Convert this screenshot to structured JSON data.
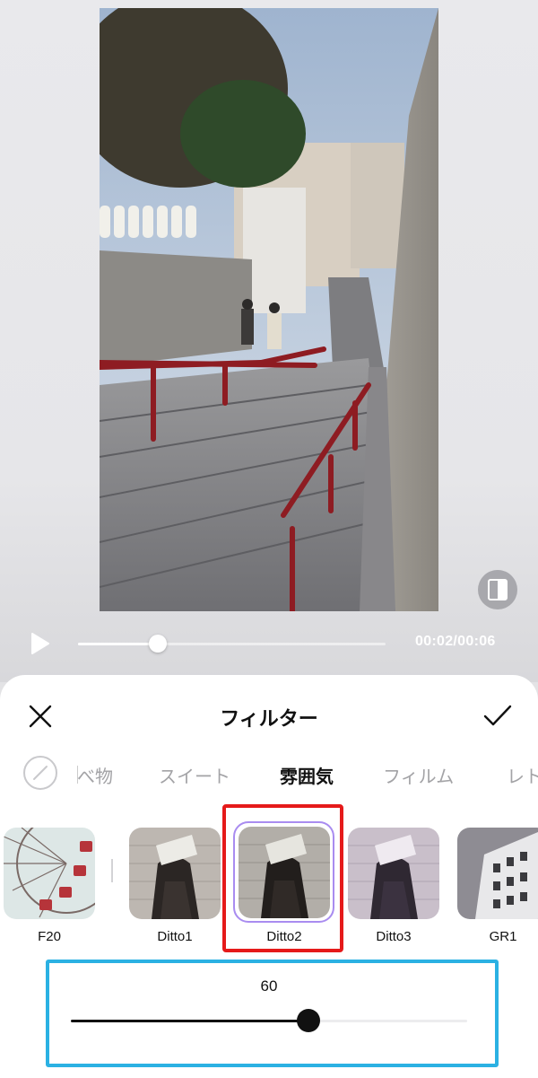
{
  "player": {
    "time_text": "00:02/00:06",
    "progress": 0.26
  },
  "panel": {
    "title": "フィルター"
  },
  "categories": [
    {
      "label": "べ物",
      "active": false
    },
    {
      "label": "スイート",
      "active": false
    },
    {
      "label": "雰囲気",
      "active": true
    },
    {
      "label": "フィルム",
      "active": false
    },
    {
      "label": "レト",
      "active": false
    }
  ],
  "filters": [
    {
      "label": "F20",
      "selected": false
    },
    {
      "label": "Ditto1",
      "selected": false
    },
    {
      "label": "Ditto2",
      "selected": true
    },
    {
      "label": "Ditto3",
      "selected": false
    },
    {
      "label": "GR1",
      "selected": false
    }
  ],
  "intensity": {
    "value_text": "60",
    "value": 60,
    "max": 100
  },
  "colors": {
    "selection_ring": "#a98cf0",
    "red_highlight": "#e51a1a",
    "blue_highlight": "#2bb1e3"
  }
}
